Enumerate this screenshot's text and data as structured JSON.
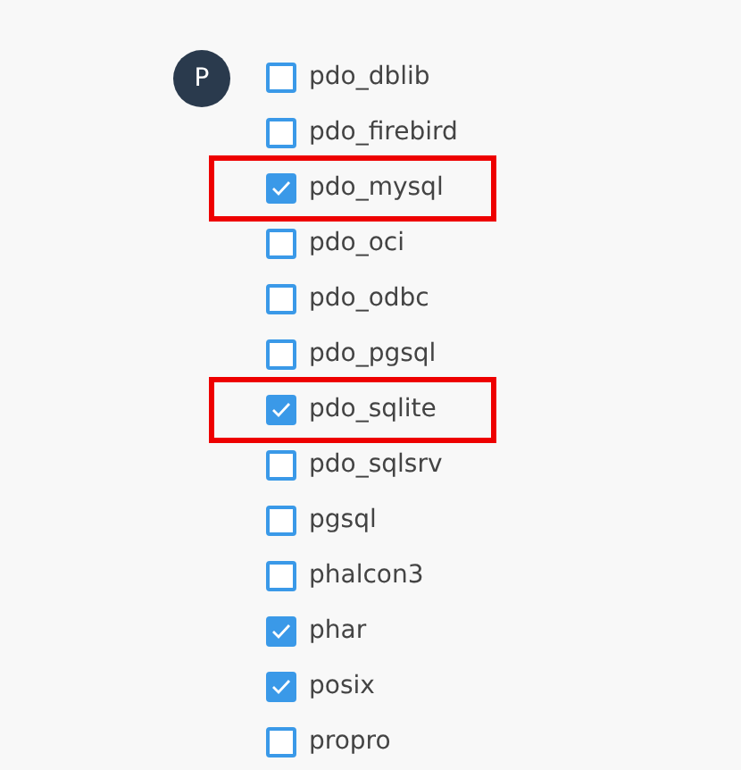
{
  "avatar": {
    "letter": "P"
  },
  "extensions": [
    {
      "name": "pdo_dblib",
      "checked": false,
      "highlighted": false
    },
    {
      "name": "pdo_firebird",
      "checked": false,
      "highlighted": false
    },
    {
      "name": "pdo_mysql",
      "checked": true,
      "highlighted": true
    },
    {
      "name": "pdo_oci",
      "checked": false,
      "highlighted": false
    },
    {
      "name": "pdo_odbc",
      "checked": false,
      "highlighted": false
    },
    {
      "name": "pdo_pgsql",
      "checked": false,
      "highlighted": false
    },
    {
      "name": "pdo_sqlite",
      "checked": true,
      "highlighted": true
    },
    {
      "name": "pdo_sqlsrv",
      "checked": false,
      "highlighted": false
    },
    {
      "name": "pgsql",
      "checked": false,
      "highlighted": false
    },
    {
      "name": "phalcon3",
      "checked": false,
      "highlighted": false
    },
    {
      "name": "phar",
      "checked": true,
      "highlighted": false
    },
    {
      "name": "posix",
      "checked": true,
      "highlighted": false
    },
    {
      "name": "propro",
      "checked": false,
      "highlighted": false
    }
  ]
}
